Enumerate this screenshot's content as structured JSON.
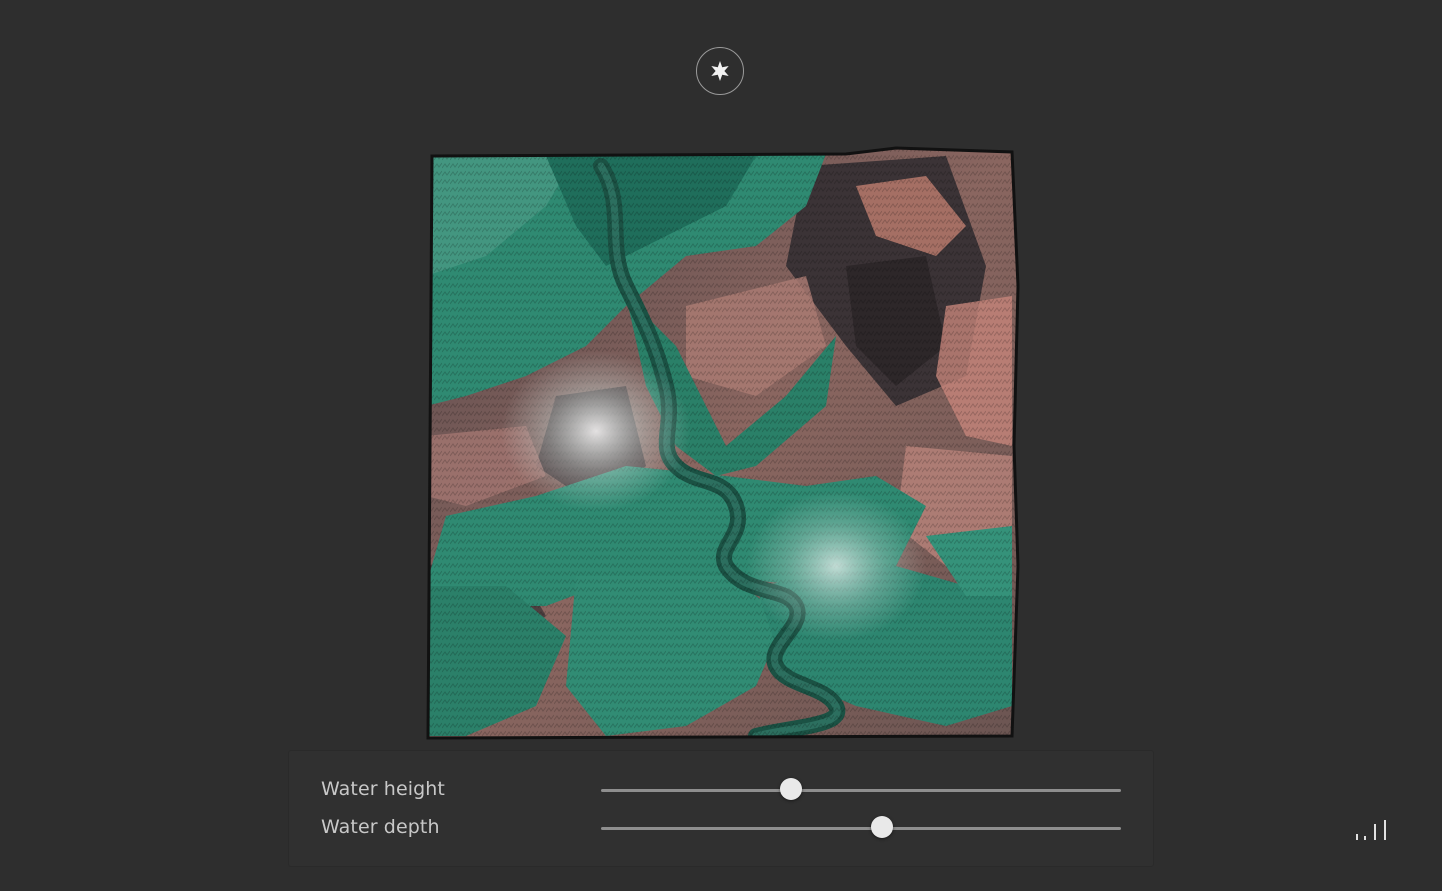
{
  "header": {
    "logo_icon": "compass-star-icon"
  },
  "viewer": {
    "image": "shaded-relief-terrain-river-canyon",
    "palette": {
      "background": "#2e2e2e",
      "water_green": "#2f8a72",
      "rock_pink": "#c98a7a",
      "shadow": "#2a2a2c"
    }
  },
  "controls": {
    "sliders": [
      {
        "label": "Water height",
        "value": 0.365
      },
      {
        "label": "Water depth",
        "value": 0.54
      }
    ]
  },
  "footer": {
    "stats_icon": "signal-bars-icon"
  }
}
